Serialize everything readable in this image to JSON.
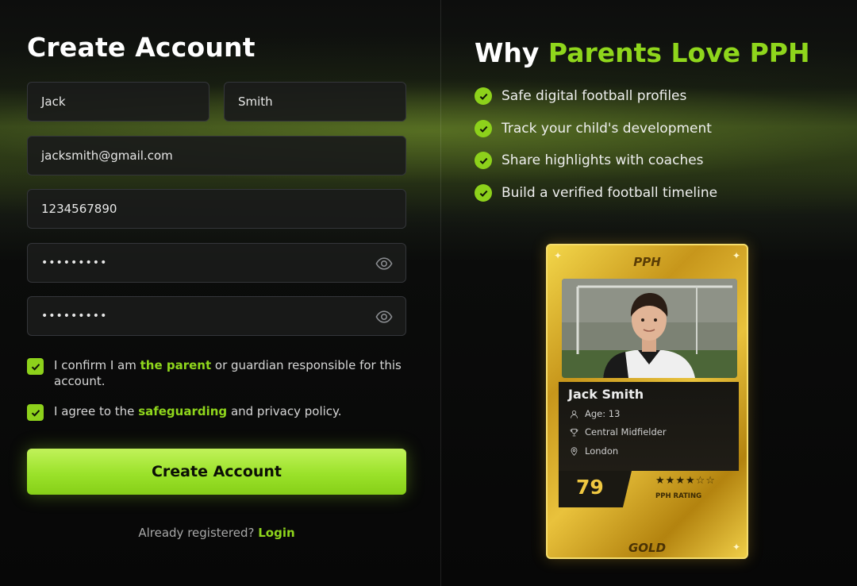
{
  "form": {
    "title": "Create Account",
    "first_name": "Jack",
    "last_name": "Smith",
    "email": "jacksmith@gmail.com",
    "phone": "1234567890",
    "password": "•••••••••",
    "confirm_password": "•••••••••",
    "confirm_parent": {
      "before": "I confirm I am ",
      "link": "the parent",
      "after": " or guardian responsible for this account."
    },
    "agree_policy": {
      "before": "I agree to the ",
      "link": "safeguarding",
      "after": " and privacy policy."
    },
    "submit_label": "Create Account",
    "login_prompt": "Already registered?",
    "login_link": "Login"
  },
  "features": {
    "heading_prefix": "Why ",
    "heading_highlight": "Parents Love PPH",
    "items": [
      "Safe digital football profiles",
      "Track your child's development",
      "Share highlights with coaches",
      "Build a verified football timeline"
    ]
  },
  "player_card": {
    "brand": "PPH",
    "name": "Jack Smith",
    "age": "Age: 13",
    "position": "Central Midfielder",
    "location": "London",
    "rating": "79",
    "stars": 4,
    "stars_max": 5,
    "rating_label": "PPH RATING",
    "tier": "GOLD"
  },
  "colors": {
    "accent": "#8dd11b",
    "gold": "#e9c23c",
    "field_bg": "#1a1b1a"
  }
}
